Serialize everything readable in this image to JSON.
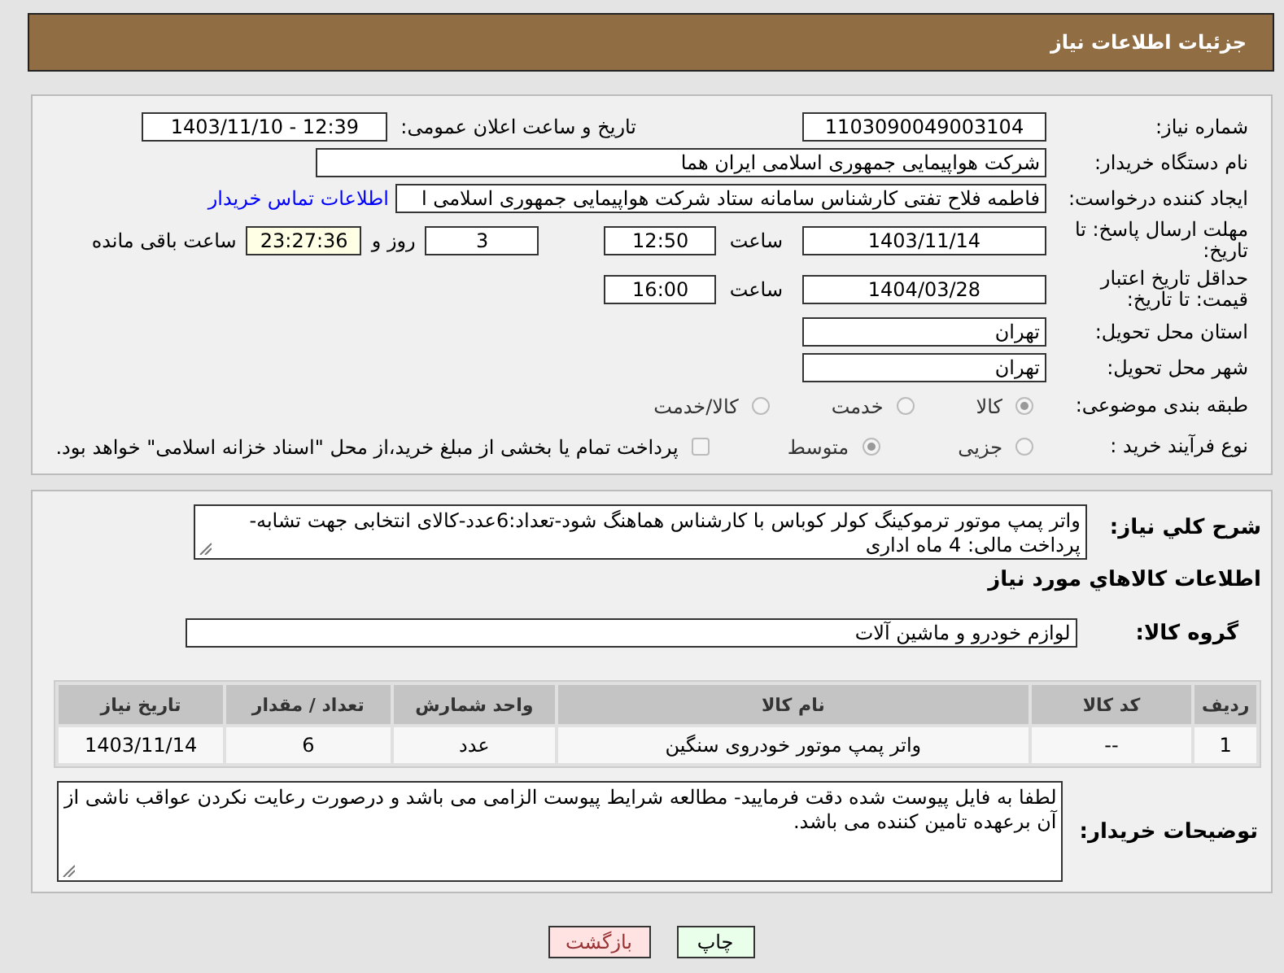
{
  "header": {
    "title": "جزئیات اطلاعات نیاز"
  },
  "details": {
    "need_number": {
      "label": "شماره نیاز:",
      "value": "1103090049003104"
    },
    "announce": {
      "label": "تاریخ و ساعت اعلان عمومی:",
      "value": "1403/11/10 - 12:39"
    },
    "buyer_org": {
      "label": "نام دستگاه خریدار:",
      "value": "شرکت هواپیمایی جمهوری اسلامی ایران هما"
    },
    "requester": {
      "label": "ایجاد کننده درخواست:",
      "value": "فاطمه فلاح تفتی کارشناس سامانه ستاد شرکت هواپیمایی جمهوری اسلامی ا",
      "link": "اطلاعات تماس خریدار"
    },
    "reply_deadline": {
      "label": "مهلت ارسال پاسخ: تا تاریخ:",
      "date": "1403/11/14",
      "time_label": "ساعت",
      "time": "12:50",
      "days": "3",
      "days_label": "روز و",
      "remaining": "23:27:36",
      "remaining_label": "ساعت باقی مانده"
    },
    "price_validity": {
      "label": "حداقل تاریخ اعتبار قیمت: تا تاریخ:",
      "date": "1404/03/28",
      "time_label": "ساعت",
      "time": "16:00"
    },
    "province": {
      "label": "استان محل تحویل:",
      "value": "تهران"
    },
    "city": {
      "label": "شهر محل تحویل:",
      "value": "تهران"
    },
    "category": {
      "label": "طبقه بندی موضوعی:",
      "options": [
        {
          "label": "كالا",
          "selected": true
        },
        {
          "label": "خدمت",
          "selected": false
        },
        {
          "label": "كالا/خدمت",
          "selected": false
        }
      ]
    },
    "process": {
      "label": "نوع فرآیند خرید :",
      "options": [
        {
          "label": "جزیی",
          "selected": false
        },
        {
          "label": "متوسط",
          "selected": true
        }
      ],
      "treasury": {
        "label": "پرداخت تمام یا بخشی از مبلغ خرید،از محل \"اسناد خزانه اسلامی\" خواهد بود.",
        "checked": false
      }
    }
  },
  "goods": {
    "description": {
      "label": "شرح کلي نياز:",
      "text": "واتر پمپ موتور ترموکینگ کولر کوباس با کارشناس هماهنگ شود-تعداد:6عدد-کالای انتخابی جهت تشابه- پرداخت مالی: 4 ماه اداری"
    },
    "section_title": "اطلاعات کالاهاي مورد نياز",
    "group": {
      "label": "گروه کالا:",
      "value": "لوازم خودرو و ماشین آلات"
    },
    "table": {
      "columns": [
        "ردیف",
        "کد کالا",
        "نام کالا",
        "واحد شمارش",
        "تعداد / مقدار",
        "تاریخ نیاز"
      ],
      "rows": [
        [
          "1",
          "--",
          "واتر پمپ موتور خودروی سنگین",
          "عدد",
          "6",
          "1403/11/14"
        ]
      ]
    },
    "notes": {
      "label": "توضیحات خریدار:",
      "text": "لطفا به فایل پیوست شده دقت فرمایید- مطالعه شرایط پیوست الزامی می باشد و درصورت رعایت نکردن عواقب ناشی از آن برعهده تامین کننده می باشد."
    }
  },
  "buttons": [
    {
      "label": "چاپ",
      "kind": "print"
    },
    {
      "label": "بازگشت",
      "kind": "back"
    }
  ]
}
